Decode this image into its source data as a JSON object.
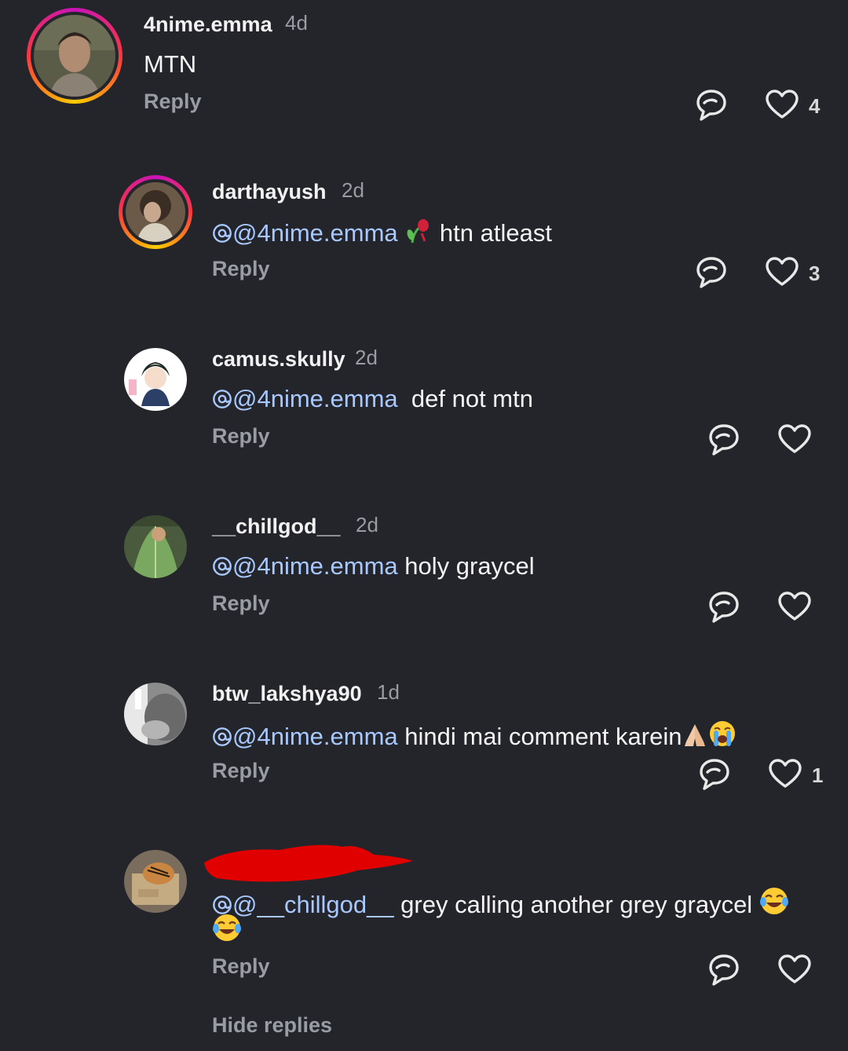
{
  "comments": [
    {
      "username": "4nime.emma",
      "time": "4d",
      "text": "MTN",
      "reply_label": "Reply",
      "likes": "4"
    },
    {
      "username": "darthayush",
      "time": "2d",
      "mention": "@4nime.emma",
      "text": " htn atleast",
      "reply_label": "Reply",
      "likes": "3"
    },
    {
      "username": "camus.skully",
      "time": "2d",
      "mention": "@4nime.emma",
      "text": "  def not mtn",
      "reply_label": "Reply",
      "likes": ""
    },
    {
      "username": "__chillgod__",
      "time": "2d",
      "mention": "@4nime.emma",
      "text": " holy graycel",
      "reply_label": "Reply",
      "likes": ""
    },
    {
      "username": "btw_lakshya90",
      "time": "1d",
      "mention": "@4nime.emma",
      "text": " hindi mai comment karein",
      "reply_label": "Reply",
      "likes": "1"
    },
    {
      "username": "",
      "time": "",
      "mention": "@__chillgod__",
      "text": " grey calling another grey graycel",
      "reply_label": "Reply",
      "likes": ""
    }
  ],
  "footer": {
    "hide_replies": "Hide replies"
  },
  "icons": {
    "repost": "repost-icon",
    "like": "heart-icon",
    "mention": "threads-at-icon"
  },
  "colors": {
    "background": "#23252a",
    "mention": "#a8c8ff",
    "secondary_text": "#9a9ca3",
    "redaction": "#e00000"
  }
}
